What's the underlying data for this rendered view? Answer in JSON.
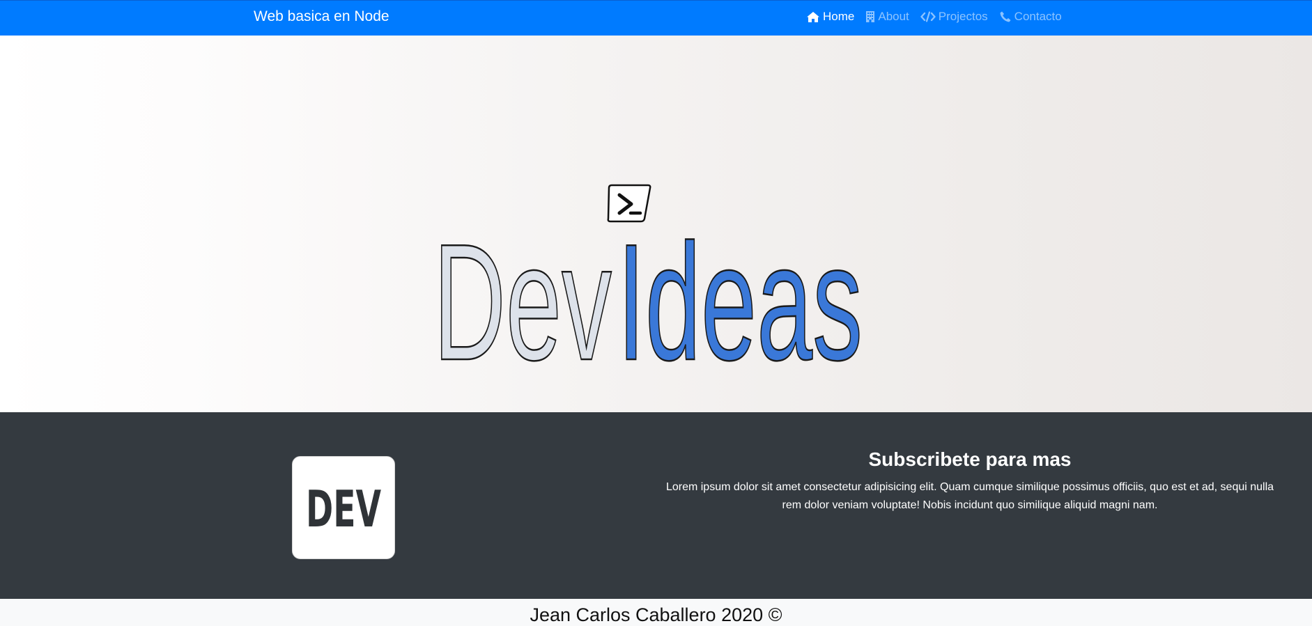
{
  "navbar": {
    "brand": "Web basica en Node",
    "items": [
      {
        "label": "Home",
        "icon": "home-icon",
        "active": true
      },
      {
        "label": "About",
        "icon": "building-icon",
        "active": false
      },
      {
        "label": "Projectos",
        "icon": "code-icon",
        "active": false
      },
      {
        "label": "Contacto",
        "icon": "phone-icon",
        "active": false
      }
    ]
  },
  "hero": {
    "logo_text": "DevIdeas",
    "logo_part_1": "Dev",
    "logo_part_2": "Ideas",
    "logo_icon": "terminal-prompt-icon"
  },
  "subscribe": {
    "badge_text": "DEV",
    "title": "Subscribete para mas",
    "text": "Lorem ipsum dolor sit amet consectetur adipisicing elit. Quam cumque similique possimus officiis, quo est et ad, sequi nulla rem dolor veniam voluptate! Nobis incidunt quo similique aliquid magni nam."
  },
  "footer": {
    "text": "Jean Carlos Caballero 2020 ©"
  },
  "colors": {
    "navbar": "#007bff",
    "dark_section": "#343a40",
    "footer": "#f8f9fa",
    "logo_blue": "#3a78d8",
    "logo_light": "#dde2ea"
  }
}
